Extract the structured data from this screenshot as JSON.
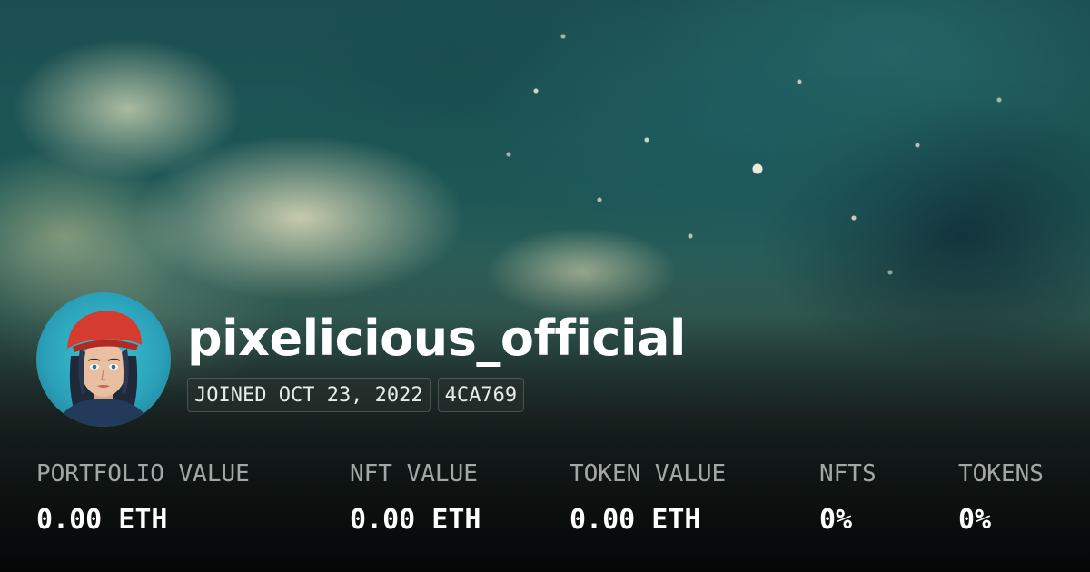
{
  "profile": {
    "username": "pixelicious_official",
    "joined": "JOINED OCT 23, 2022",
    "address_tag": "4CA769"
  },
  "stats": [
    {
      "label": "PORTFOLIO VALUE",
      "value": "0.00 ETH"
    },
    {
      "label": "NFT VALUE",
      "value": "0.00 ETH"
    },
    {
      "label": "TOKEN VALUE",
      "value": "0.00 ETH"
    },
    {
      "label": "NFTS",
      "value": "0%"
    },
    {
      "label": "TOKENS",
      "value": "0%"
    }
  ],
  "colors": {
    "text": "#ffffff",
    "label": "#c8cecb",
    "tag_background": "#28322e"
  }
}
